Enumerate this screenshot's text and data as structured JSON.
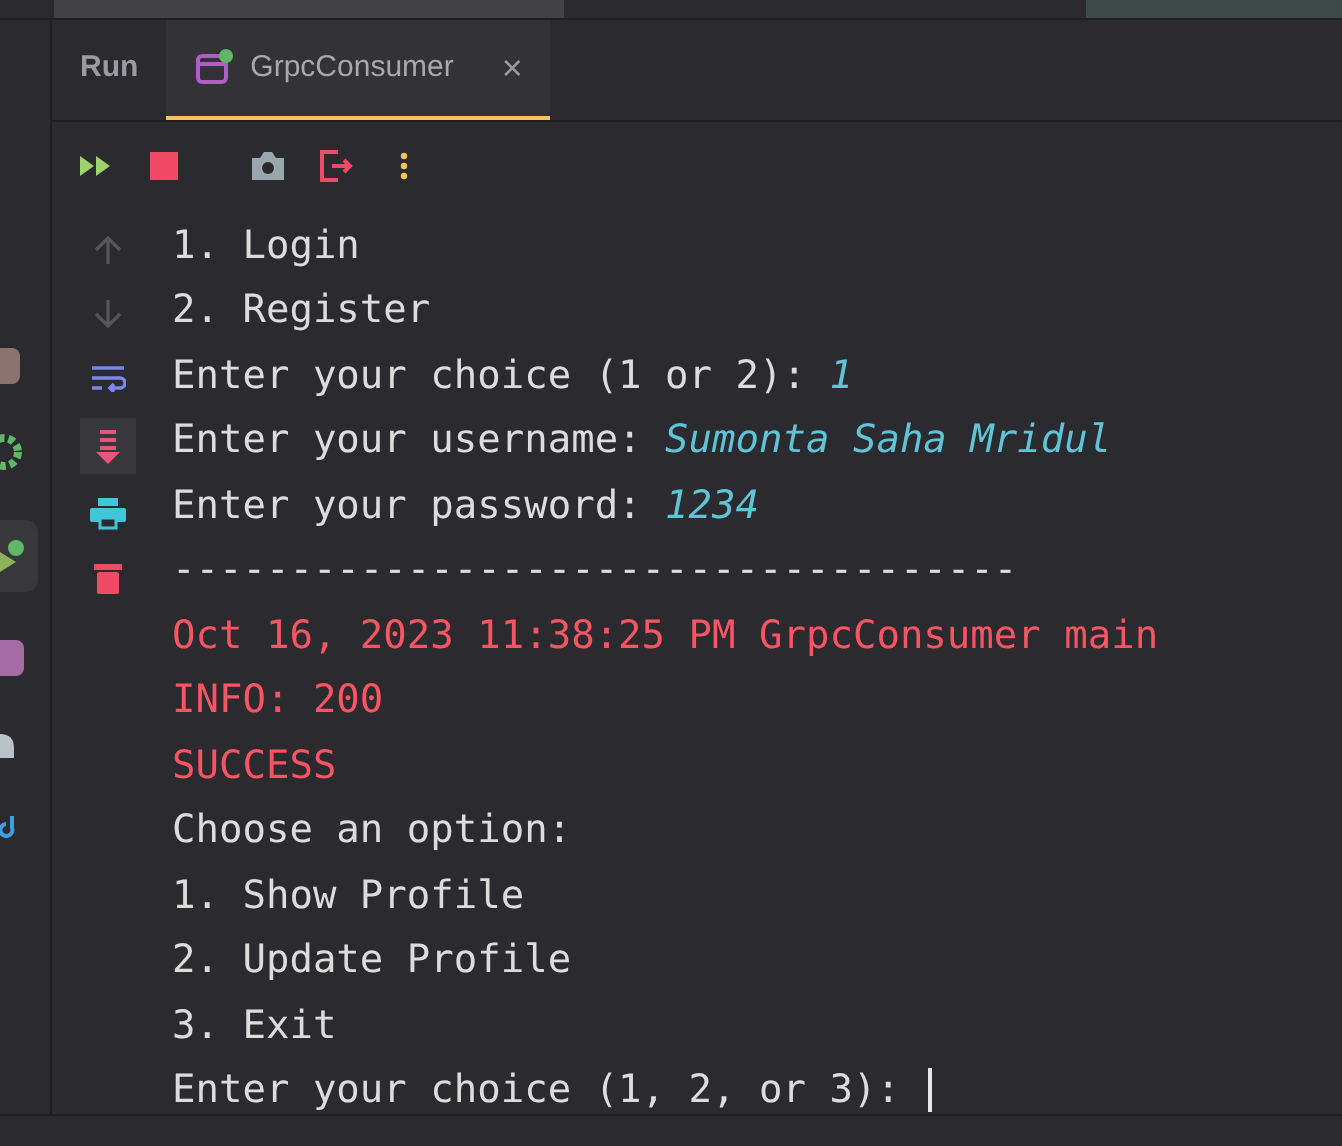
{
  "tabs": [
    {
      "label": "Run",
      "kind": "title",
      "selected": false
    },
    {
      "label": "GrpcConsumer",
      "kind": "config",
      "selected": true,
      "close": "×"
    }
  ],
  "console": [
    {
      "kind": "plain",
      "text": "1. Login"
    },
    {
      "kind": "plain",
      "text": "2. Register"
    },
    {
      "kind": "prompt",
      "text": "Enter your choice (1 or 2): ",
      "input": "1"
    },
    {
      "kind": "prompt",
      "text": "Enter your username: ",
      "input": "Sumonta Saha Mridul"
    },
    {
      "kind": "prompt",
      "text": "Enter your password: ",
      "input": "1234"
    },
    {
      "kind": "plain",
      "text": "------------------------------------"
    },
    {
      "kind": "error",
      "text": "Oct 16, 2023 11:38:25 PM GrpcConsumer main"
    },
    {
      "kind": "error",
      "text": "INFO: 200"
    },
    {
      "kind": "error",
      "text": "SUCCESS"
    },
    {
      "kind": "plain",
      "text": "Choose an option:"
    },
    {
      "kind": "plain",
      "text": "1. Show Profile"
    },
    {
      "kind": "plain",
      "text": "2. Update Profile"
    },
    {
      "kind": "plain",
      "text": "3. Exit"
    },
    {
      "kind": "prompt",
      "text": "Enter your choice (1, 2, or 3): ",
      "cursor": true
    }
  ]
}
